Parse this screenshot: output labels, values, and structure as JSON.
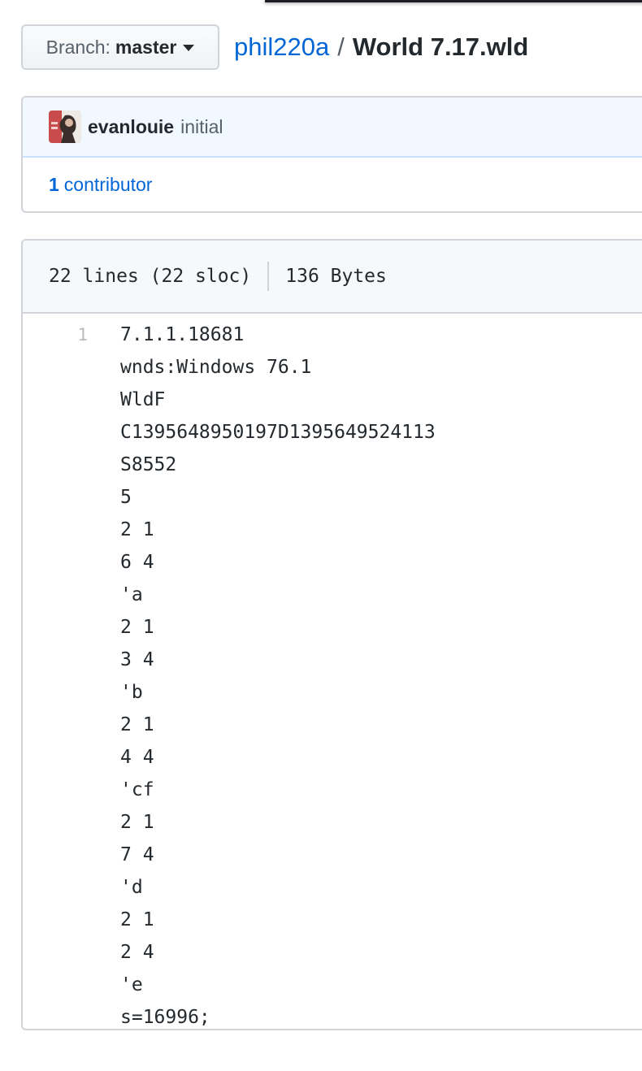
{
  "branch": {
    "label": "Branch:",
    "value": "master"
  },
  "breadcrumb": {
    "repo": "phil220a",
    "separator": "/",
    "file": "World 7.17.wld"
  },
  "commit": {
    "author": "evanlouie",
    "message": "initial",
    "avatar_icon": "user-avatar-photo"
  },
  "contributors": {
    "count": "1",
    "label": "contributor"
  },
  "file_info": {
    "lines": "22 lines (22 sloc)",
    "size": "136 Bytes"
  },
  "code": {
    "first_line_number": "1",
    "lines": [
      "7.1.1.18681",
      "wnds:Windows 76.1",
      "WldF",
      "C1395648950197D1395649524113",
      "S8552",
      "5",
      "2 1",
      "6 4",
      "'a",
      "2 1",
      "3 4",
      "'b",
      "2 1",
      "4 4",
      "'cf",
      "2 1",
      "7 4",
      "'d",
      "2 1",
      "2 4",
      "'e",
      "s=16996;"
    ]
  },
  "colors": {
    "link": "#0366d6",
    "commit_bg": "#f1f8ff",
    "border": "#d1d5da"
  }
}
